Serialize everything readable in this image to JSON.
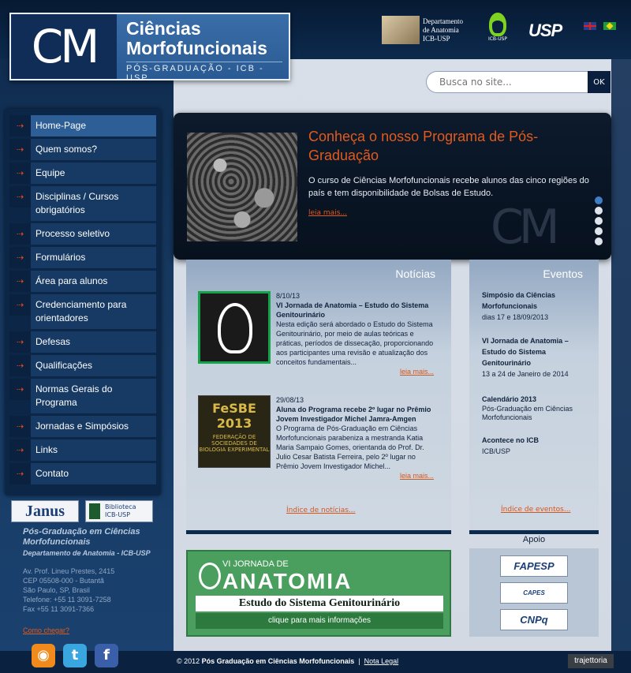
{
  "logo": {
    "mark": "CM",
    "line1": "Ciências",
    "line2": "Morfofuncionais",
    "subtitle": "PÓS-GRADUAÇÃO - ICB - USP"
  },
  "header": {
    "dept_line1": "Departamento",
    "dept_line2": "de Anatomia",
    "dept_line3": "ICB-USP",
    "icb_label": "ICB-USP",
    "usp_label": "USP"
  },
  "search": {
    "placeholder": "Busca no site...",
    "button": "OK"
  },
  "nav": {
    "items": [
      {
        "label": "Home-Page"
      },
      {
        "label": "Quem somos?"
      },
      {
        "label": "Equipe"
      },
      {
        "label": "Disciplinas / Cursos obrigatórios"
      },
      {
        "label": "Processo seletivo"
      },
      {
        "label": "Formulários"
      },
      {
        "label": "Área para alunos"
      },
      {
        "label": "Credenciamento para orientadores"
      },
      {
        "label": "Defesas"
      },
      {
        "label": "Qualificações"
      },
      {
        "label": "Normas Gerais do Programa"
      },
      {
        "label": "Jornadas e Simpósios"
      },
      {
        "label": "Links"
      },
      {
        "label": "Contato"
      }
    ],
    "arrow": "⇢"
  },
  "sidebar": {
    "janus": "Janus",
    "biblio_line1": "Biblioteca",
    "biblio_line2": "ICB-USP",
    "title": "Pós-Graduação em Ciências Morfofuncionais",
    "dept": "Departamento de Anatomia - ICB-USP",
    "address": [
      "Av. Prof. Lineu Prestes, 2415",
      "CEP 05508-000 - Butantã",
      "São Paulo, SP, Brasil",
      "Telefone: +55 11 3091-7258",
      "Fax +55 11 3091-7366"
    ],
    "directions": "Como chegar?"
  },
  "slider": {
    "title": "Conheça o nosso Programa de Pós-Graduação",
    "text": "O curso de Ciências Morfofuncionais recebe alunos das cinco regiões do país e tem disponibilidade de Bolsas de Estudo.",
    "more": "leia mais...",
    "watermark": "CM"
  },
  "news": {
    "heading": "Notícias",
    "items": [
      {
        "date": "8/10/13",
        "title": "VI Jornada de Anatomia – Estudo do Sistema Genitourinário",
        "text": "Nesta edição será abordado o Estudo do Sistema Genitourinário, por meio de aulas teóricas e práticas, períodos de dissecação, proporcionando aos participantes uma revisão e atualização dos conceitos fundamentais...",
        "more": "leia mais..."
      },
      {
        "date": "29/08/13",
        "title": "Aluna do Programa recebe 2º lugar no Prêmio Jovem Investigador Michel Jamra-Amgen",
        "text": "O Programa de Pós-Graduação em Ciências Morfofuncionais parabeniza a mestranda Katia Maria Sampaio Gomes, orientanda do Prof. Dr. Julio Cesar Batista Ferreira, pelo 2º lugar no Prêmio Jovem Investigador Michel...",
        "more": "leia mais..."
      }
    ],
    "fesbe_name": "FeSBE",
    "fesbe_year": "2013",
    "fesbe_text": "FEDERAÇÃO DE SOCIEDADES DE BIOLOGIA EXPERIMENTAL",
    "index": "Índice de notícias..."
  },
  "events": {
    "heading": "Eventos",
    "items": [
      {
        "title": "Simpósio da Ciências Morfofuncionais",
        "detail": "dias 17 e 18/09/2013"
      },
      {
        "title": "VI Jornada de Anatomia – Estudo do Sistema Genitourinário",
        "detail": "13 a 24 de Janeiro de 2014"
      },
      {
        "title": "Calendário 2013",
        "detail": "Pós-Graduação em Ciências Morfofuncionais"
      },
      {
        "title": "Acontece no ICB",
        "detail": "ICB/USP"
      }
    ],
    "index": "Índice de eventos..."
  },
  "banner": {
    "small": "VI JORNADA DE",
    "big": "ANATOMIA",
    "sub": "Estudo do Sistema Genitourinário",
    "cta": "clique para mais informações"
  },
  "apoio": {
    "title": "Apoio",
    "sponsors": [
      "FAPESP",
      "CAPES",
      "CNPq"
    ]
  },
  "footer": {
    "copyright_prefix": "© 2012",
    "copyright_name": "Pós Graduação em Ciências Morfofuncionais",
    "separator": "|",
    "legal": "Nota Legal",
    "credit": "trajettoria",
    "social": [
      "RSS",
      "Twitter",
      "Facebook"
    ]
  }
}
